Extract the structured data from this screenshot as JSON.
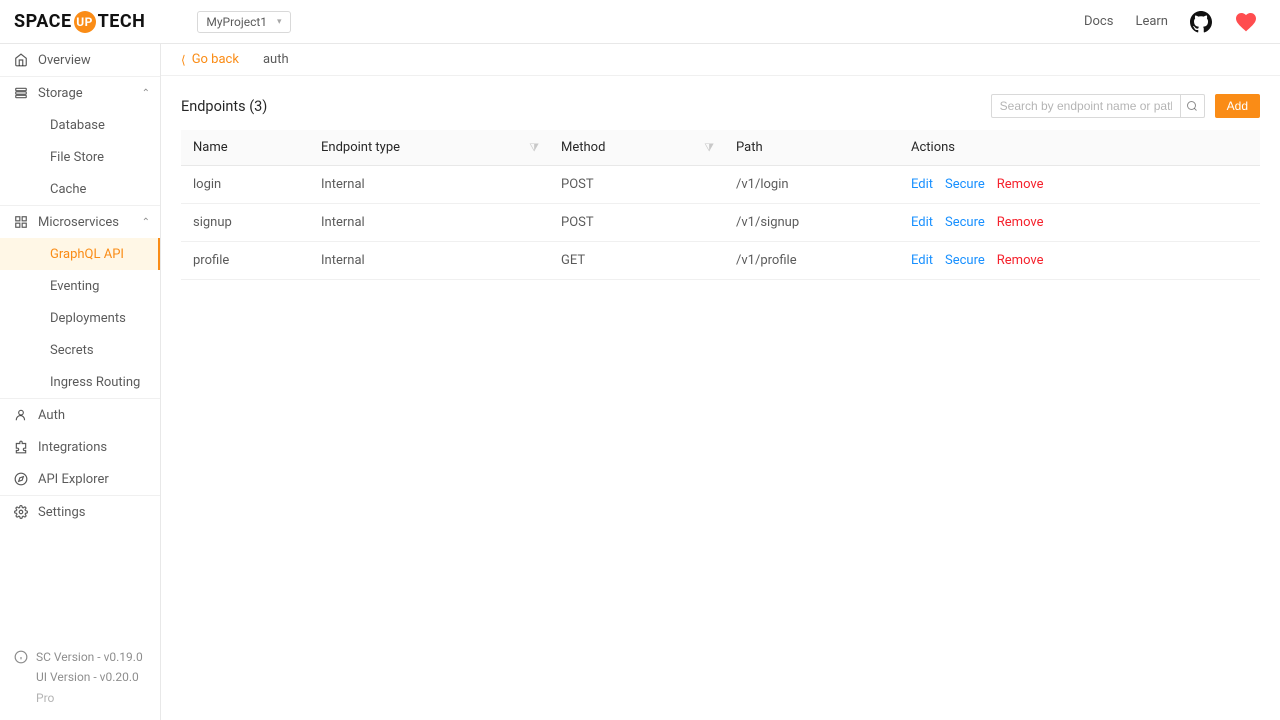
{
  "header": {
    "project": "MyProject1",
    "links": {
      "docs": "Docs",
      "learn": "Learn"
    }
  },
  "sidebar": {
    "items": [
      {
        "label": "Overview",
        "icon": "home"
      },
      {
        "label": "Storage",
        "icon": "db",
        "expandable": true,
        "children": [
          {
            "label": "Database"
          },
          {
            "label": "File Store"
          },
          {
            "label": "Cache"
          }
        ]
      },
      {
        "label": "Microservices",
        "icon": "services",
        "expandable": true,
        "children": [
          {
            "label": "GraphQL API",
            "active": true
          },
          {
            "label": "Eventing"
          },
          {
            "label": "Deployments"
          },
          {
            "label": "Secrets"
          },
          {
            "label": "Ingress Routing"
          }
        ]
      },
      {
        "label": "Auth",
        "icon": "user"
      },
      {
        "label": "Integrations",
        "icon": "puzzle"
      },
      {
        "label": "API Explorer",
        "icon": "compass"
      },
      {
        "label": "Settings",
        "icon": "gear"
      }
    ],
    "footer": {
      "sc": "SC Version - v0.19.0",
      "ui": "UI Version - v0.20.0",
      "plan": "Pro"
    }
  },
  "breadcrumb": {
    "back": "Go back",
    "crumb": "auth"
  },
  "page": {
    "title": "Endpoints (3)",
    "search_placeholder": "Search by endpoint name or path",
    "add": "Add"
  },
  "table": {
    "headers": {
      "name": "Name",
      "type": "Endpoint type",
      "method": "Method",
      "path": "Path",
      "actions": "Actions"
    },
    "actions": {
      "edit": "Edit",
      "secure": "Secure",
      "remove": "Remove"
    },
    "rows": [
      {
        "name": "login",
        "type": "Internal",
        "method": "POST",
        "path": "/v1/login"
      },
      {
        "name": "signup",
        "type": "Internal",
        "method": "POST",
        "path": "/v1/signup"
      },
      {
        "name": "profile",
        "type": "Internal",
        "method": "GET",
        "path": "/v1/profile"
      }
    ]
  },
  "colors": {
    "accent": "#fa8c16",
    "link": "#1890ff",
    "danger": "#f5222d"
  }
}
